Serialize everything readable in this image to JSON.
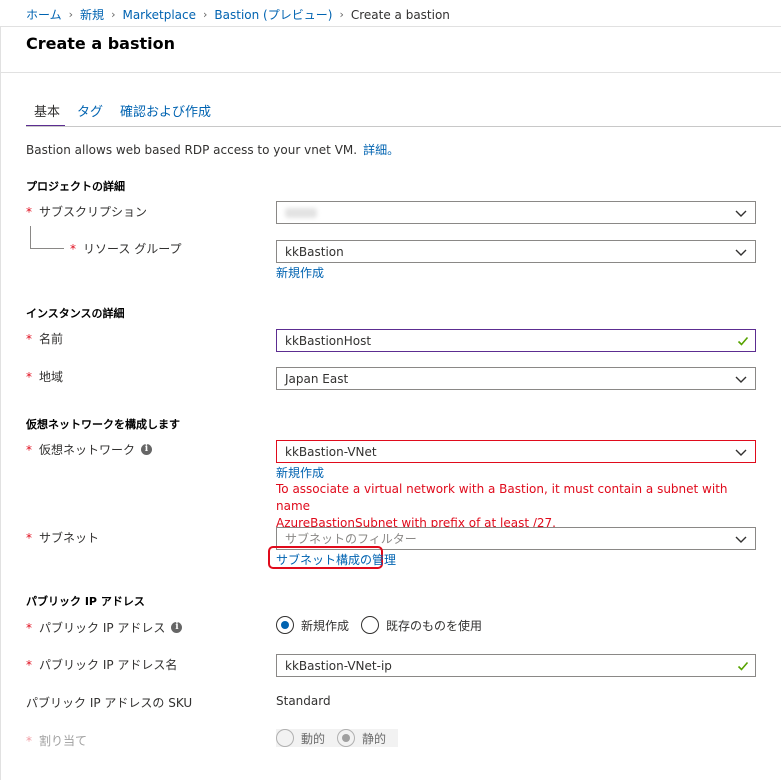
{
  "breadcrumb": {
    "items": [
      "ホーム",
      "新規",
      "Marketplace",
      "Bastion (プレビュー)"
    ],
    "current": "Create a bastion",
    "separator": "›"
  },
  "page": {
    "title": "Create a bastion"
  },
  "tabs": [
    {
      "label": "基本",
      "active": true
    },
    {
      "label": "タグ",
      "active": false
    },
    {
      "label": "確認および作成",
      "active": false
    }
  ],
  "intro": {
    "text": "Bastion allows web based RDP access to your vnet VM.",
    "link": "詳細。"
  },
  "project": {
    "heading": "プロジェクトの詳細",
    "subscription": {
      "label": "サブスクリプション",
      "value": ""
    },
    "resource_group": {
      "label": "リソース グループ",
      "value": "kkBastion",
      "create_new": "新規作成"
    }
  },
  "instance": {
    "heading": "インスタンスの詳細",
    "name": {
      "label": "名前",
      "value": "kkBastionHost"
    },
    "region": {
      "label": "地域",
      "value": "Japan East"
    }
  },
  "network": {
    "heading": "仮想ネットワークを構成します",
    "vnet": {
      "label": "仮想ネットワーク",
      "value": "kkBastion-VNet",
      "create_new": "新規作成",
      "error_line1": "To associate a virtual network with a Bastion, it must contain a subnet with name",
      "error_line2": "AzureBastionSubnet with prefix of at least /27."
    },
    "subnet": {
      "label": "サブネット",
      "placeholder": "サブネットのフィルター",
      "manage_link": "サブネット構成の管理"
    }
  },
  "public_ip": {
    "heading": "パブリック IP アドレス",
    "address": {
      "label": "パブリック IP アドレス",
      "option_new": "新規作成",
      "option_existing": "既存のものを使用"
    },
    "name": {
      "label": "パブリック IP アドレス名",
      "value": "kkBastion-VNet-ip"
    },
    "sku": {
      "label": "パブリック IP アドレスの SKU",
      "value": "Standard"
    },
    "assignment": {
      "label": "割り当て",
      "option_dynamic": "動的",
      "option_static": "静的"
    }
  },
  "required_marker": "*",
  "info_glyph": "i",
  "colors": {
    "link": "#0063b1",
    "error": "#e00b1c",
    "accent": "#5c2d91",
    "success": "#57a300"
  }
}
